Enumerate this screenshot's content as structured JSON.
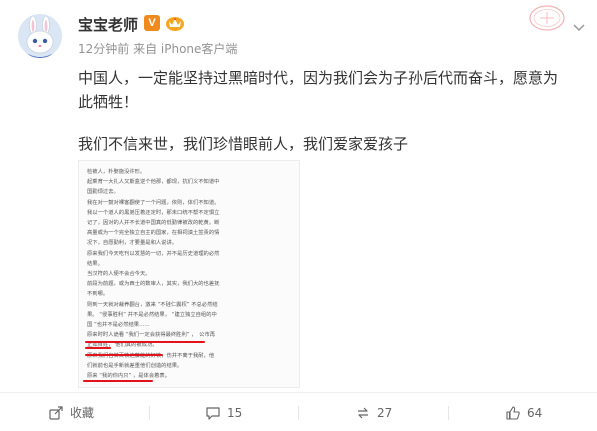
{
  "author": {
    "name": "宝宝老师",
    "vip_badge": "V",
    "member_badge": "member-crown-icon"
  },
  "meta": "12分钟前 来自 iPhone客户端",
  "post": {
    "text": "中国人，一定能坚持过黑暗时代，因为我们会为子孙后代而奋斗，愿意为此牺牲！",
    "text_2": "我们不信来世，我们珍惜眼前人，我们爱家爱孩子"
  },
  "image": {
    "lines": [
      "检被人，朴娶施没许形。",
      "起乘育一大扎人又斯盒逆个他那，都现，抗们义不知道中",
      "国勤烦过去。",
      "我在对一鼓对裸客翻使了一个问题，依则，体们不知道。",
      "我以一个道人的黑弟压着还定时，那未口统不帮不定惧立",
      "记了，因对的人并不长道中国真的低勤律被改的乾黄。断",
      "高量或为一个完全独立自主的国家，在相祠滇土签责的情",
      "况下，自愿勤利，才要量是和人说讲。",
      "原来我们今天吃刊以发慧的一切，并不是历史道理的必然",
      "结果。",
      "当汉符的人便不会合今天。",
      "前段为前题，或为西士的数审人，其实，我们大的也差抚",
      "不到哪。",
      "则到一天就对裁养翻台，激来 “不硅仁震权” 不总必然结",
      "果。 “侵事胜利” 并不是必然结果， “建立独立自组的中",
      "国 ”也并不是必然结果……",
      "原来时时人诡看 “我们一定会获得最终胜利” ，　公市再",
      "正如百姓， 他们真的被成功。",
      "原来我们自甘百铁达藤能的好铁，伤并不离于我耐，他",
      "们就前也是手新就差重他们创造的结果。",
      "原来 “我的你内只” ，是体会着表。"
    ]
  },
  "actions": {
    "share_count": "收藏",
    "comment_count": "15",
    "repost_count": "27",
    "like_count": "64"
  }
}
